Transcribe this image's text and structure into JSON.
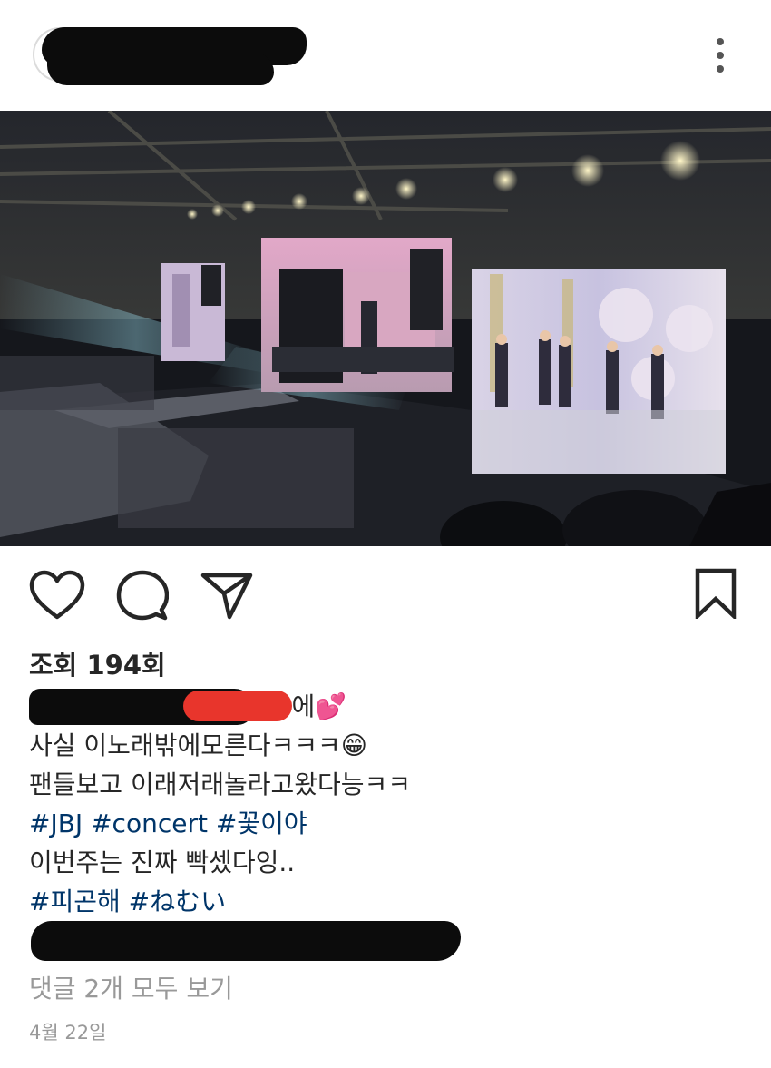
{
  "post": {
    "views_text": "조회 194회",
    "caption_lines": [
      {
        "type": "text",
        "text": "덕분에💕"
      },
      {
        "type": "text",
        "text": "사실 이노래밖에모른다ㅋㅋㅋ😁"
      },
      {
        "type": "text",
        "text": "팬들보고 이래저래놀라고왔다능ㅋㅋ"
      },
      {
        "type": "tags",
        "tags": [
          "#JBJ",
          "#concert",
          "#꽃이야"
        ]
      },
      {
        "type": "text",
        "text": "이번주는 진짜 빡셌다잉.."
      },
      {
        "type": "tags",
        "tags": [
          "#피곤해",
          "#ねむい"
        ]
      }
    ],
    "view_comments_text": "댓글 2개 모두 보기",
    "date_text": "4월 22일"
  },
  "icons": {
    "more": "more-vertical-icon",
    "like": "heart-icon",
    "comment": "comment-bubble-icon",
    "share": "paper-plane-icon",
    "save": "bookmark-icon"
  },
  "colors": {
    "hashtag": "#003569",
    "muted": "#999999",
    "text": "#262626"
  }
}
